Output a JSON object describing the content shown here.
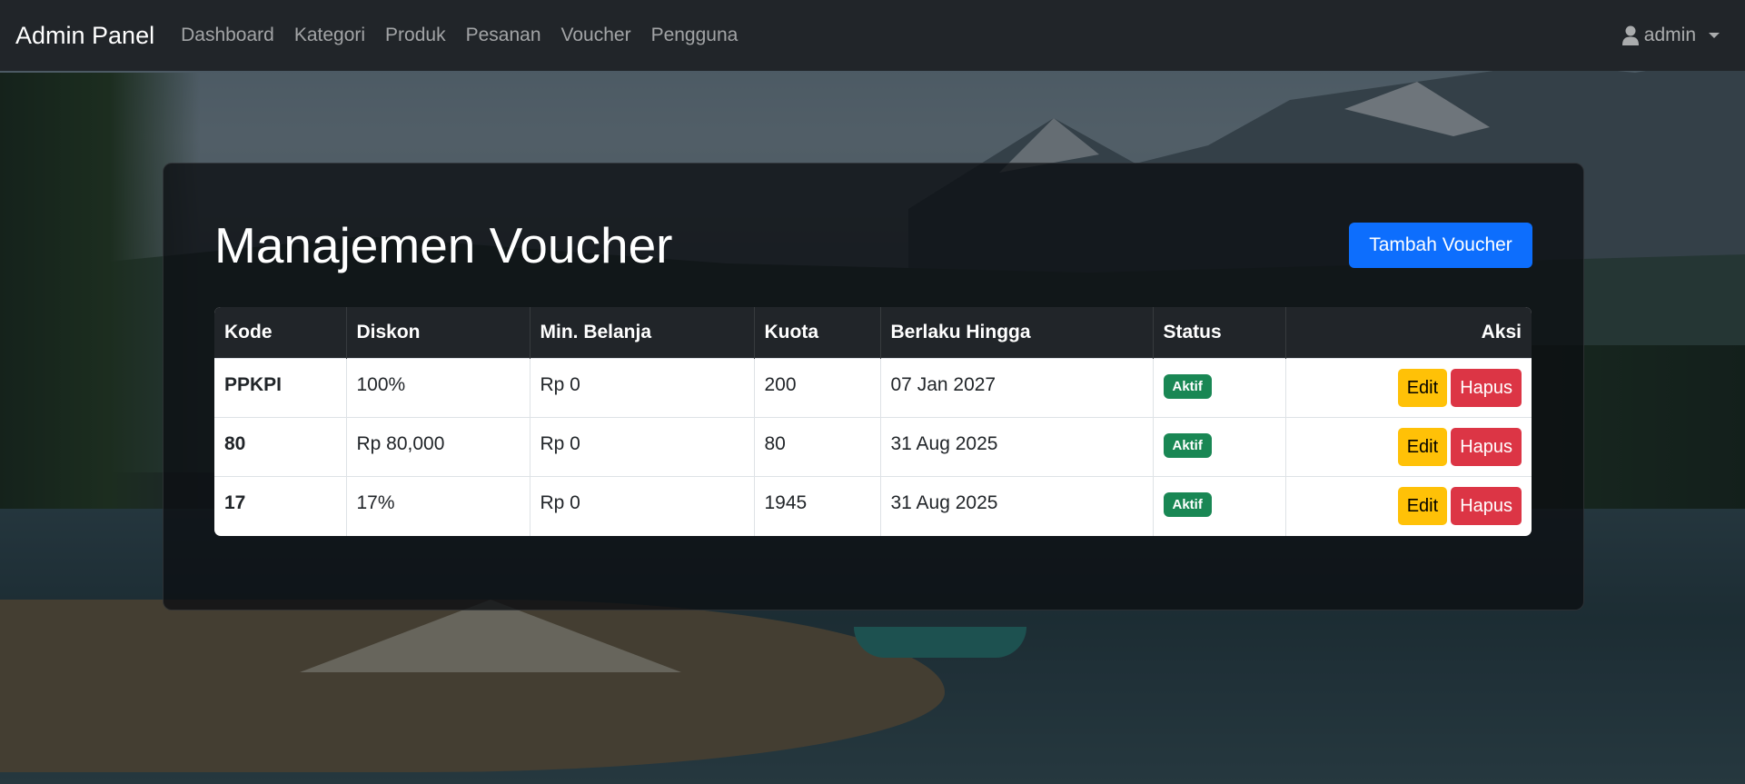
{
  "navbar": {
    "brand": "Admin Panel",
    "links": [
      "Dashboard",
      "Kategori",
      "Produk",
      "Pesanan",
      "Voucher",
      "Pengguna"
    ],
    "user": {
      "icon": "user-icon",
      "name": "admin"
    }
  },
  "main": {
    "title": "Manajemen Voucher",
    "add_button": "Tambah Voucher",
    "table": {
      "headers": [
        "Kode",
        "Diskon",
        "Min. Belanja",
        "Kuota",
        "Berlaku Hingga",
        "Status",
        "Aksi"
      ],
      "rows": [
        {
          "code": "PPKPI",
          "discount": "100%",
          "min_purchase": "Rp 0",
          "quota": "200",
          "valid_until": "07 Jan 2027",
          "status": "Aktif",
          "edit": "Edit",
          "delete": "Hapus"
        },
        {
          "code": "80",
          "discount": "Rp 80,000",
          "min_purchase": "Rp 0",
          "quota": "80",
          "valid_until": "31 Aug 2025",
          "status": "Aktif",
          "edit": "Edit",
          "delete": "Hapus"
        },
        {
          "code": "17",
          "discount": "17%",
          "min_purchase": "Rp 0",
          "quota": "1945",
          "valid_until": "31 Aug 2025",
          "status": "Aktif",
          "edit": "Edit",
          "delete": "Hapus"
        }
      ]
    }
  },
  "colors": {
    "navbar": "#212529",
    "primary": "#0d6efd",
    "success": "#198754",
    "warning": "#ffc107",
    "danger": "#dc3545"
  }
}
